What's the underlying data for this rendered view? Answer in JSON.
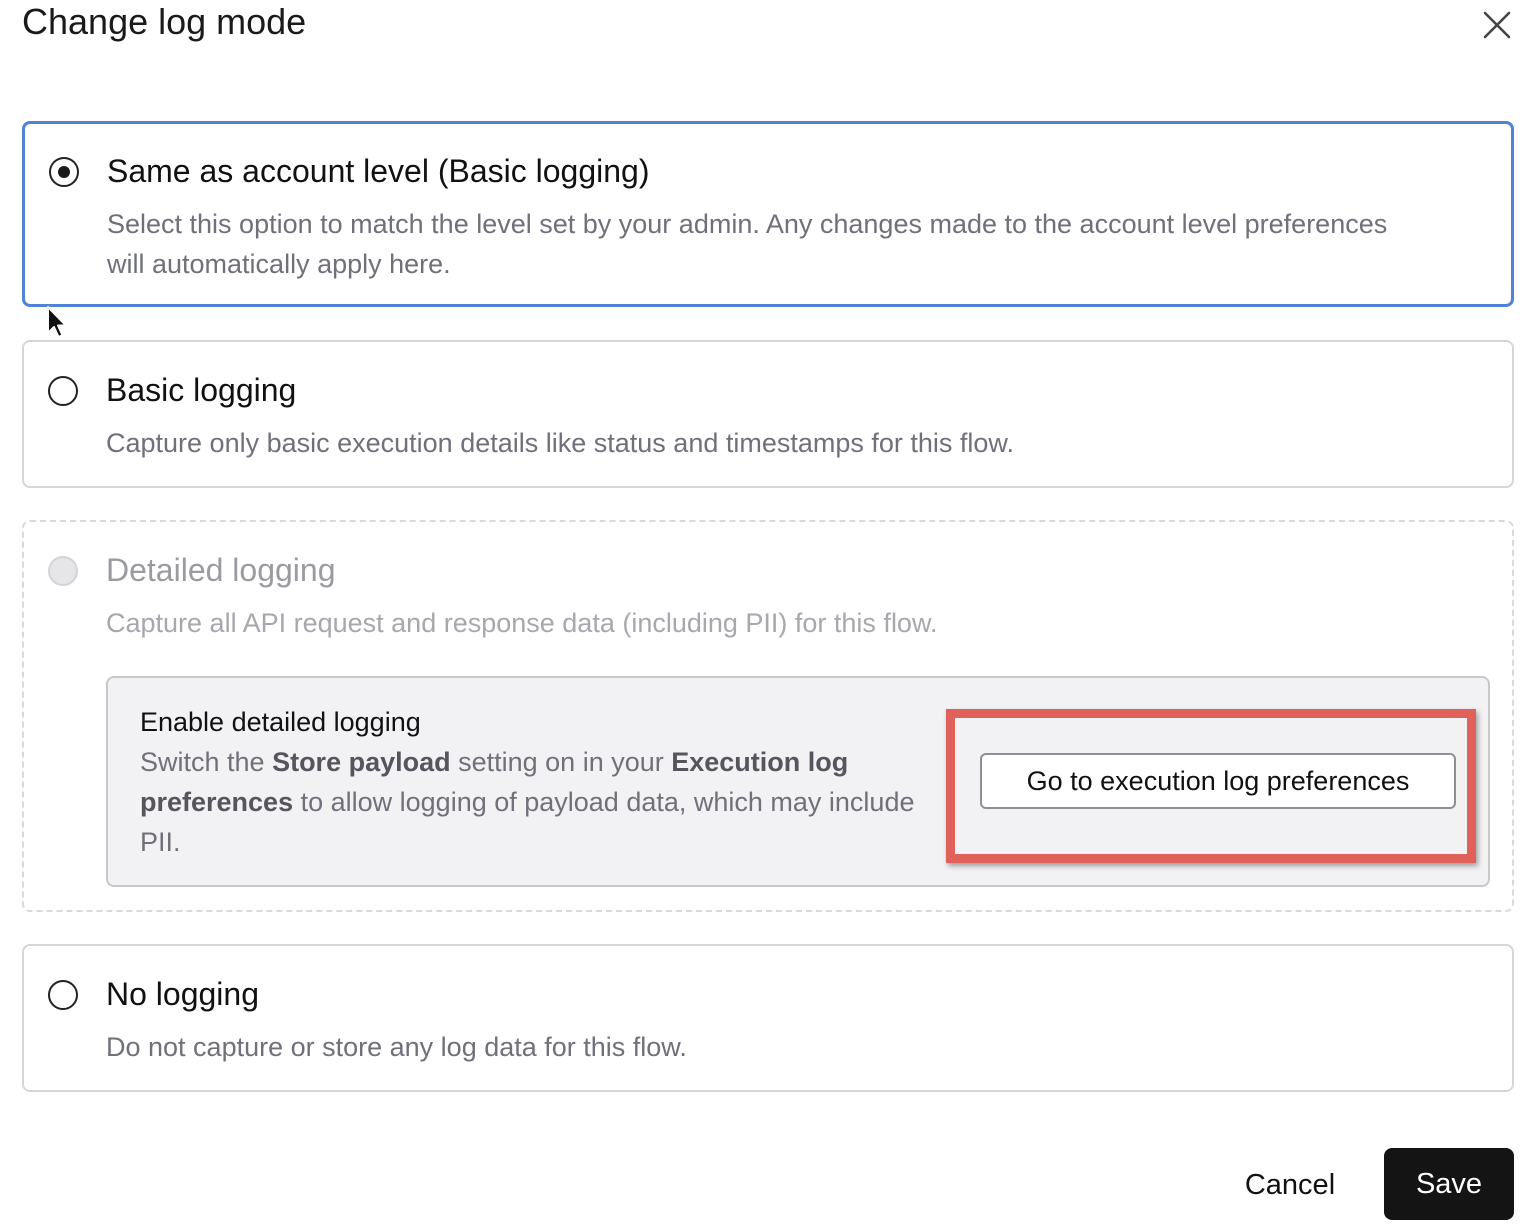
{
  "dialog": {
    "title": "Change log mode",
    "close_icon": "close-icon"
  },
  "options": [
    {
      "title": "Same as account level (Basic logging)",
      "description": "Select this option to match the level set by your admin. Any changes made to the account level preferences will automatically apply here.",
      "selected": true,
      "disabled": false
    },
    {
      "title": "Basic logging",
      "description": "Capture only basic execution details like status and timestamps for this flow.",
      "selected": false,
      "disabled": false
    },
    {
      "title": "Detailed logging",
      "description": "Capture all API request and response data (including PII) for this flow.",
      "selected": false,
      "disabled": true
    },
    {
      "title": "No logging",
      "description": "Do not capture or store any log data for this flow.",
      "selected": false,
      "disabled": false
    }
  ],
  "info": {
    "title": "Enable detailed logging",
    "text_1": "Switch the ",
    "bold_1": "Store payload",
    "text_2": " setting on in your ",
    "bold_2": "Execution log preferences",
    "text_3": " to allow logging of payload data, which may include PII.",
    "button_label": "Go to execution log preferences"
  },
  "footer": {
    "cancel_label": "Cancel",
    "save_label": "Save"
  },
  "colors": {
    "selected_border": "#4f82d8",
    "highlight": "#e0605a",
    "primary_button": "#141414"
  }
}
